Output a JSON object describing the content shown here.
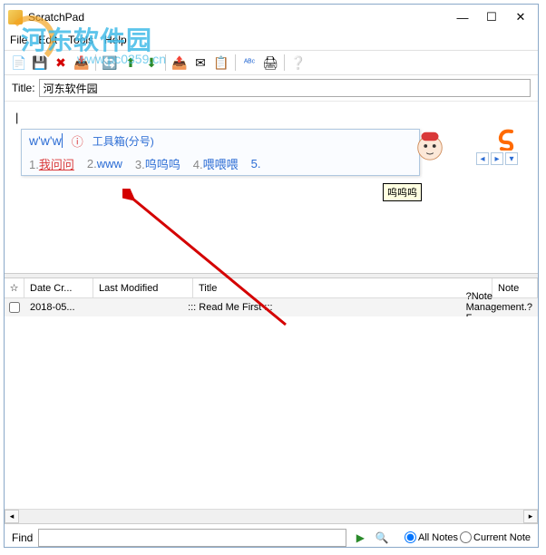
{
  "window": {
    "title": "ScratchPad",
    "min": "—",
    "max": "☐",
    "close": "✕"
  },
  "menu": {
    "file": "File",
    "edit": "Edit",
    "tools": "Tools",
    "help": "Help"
  },
  "watermark": {
    "text": "河东软件园",
    "url": "www.pc0359.cn"
  },
  "toolbar_icons": {
    "new": "📄",
    "save": "💾",
    "delete": "✖",
    "import": "📥",
    "refresh": "🔄",
    "up": "⬆",
    "down": "⬇",
    "moveup": "📤",
    "mail": "✉",
    "copy": "📋",
    "spell": "ᴬᴮᶜ",
    "print": "🖨",
    "help": "❔"
  },
  "title_field": {
    "label": "Title:",
    "value": "河东软件园"
  },
  "editor": {
    "cursor": "|"
  },
  "ime": {
    "input": "w'w'w",
    "toolbox": "工具箱(分号)",
    "cand1_num": "1.",
    "cand1": "我问问",
    "cand2_num": "2.",
    "cand2": "www",
    "cand3_num": "3.",
    "cand3": "呜呜呜",
    "cand4_num": "4.",
    "cand4": "喂喂喂",
    "cand5_num": "5.",
    "tooltip": "呜呜呜",
    "nav_prev": "◂",
    "nav_next": "▸",
    "nav_more": "▾"
  },
  "list": {
    "headers": {
      "date": "Date Cr...",
      "modified": "Last Modified",
      "title": "Title",
      "note": "Note"
    },
    "rows": [
      {
        "date": "2018-05...",
        "modified": "",
        "title": "::: Read Me First :::",
        "note": "?Note Management.?F"
      }
    ]
  },
  "find": {
    "label": "Find",
    "all_notes": "All Notes",
    "current_note": "Current Note"
  }
}
